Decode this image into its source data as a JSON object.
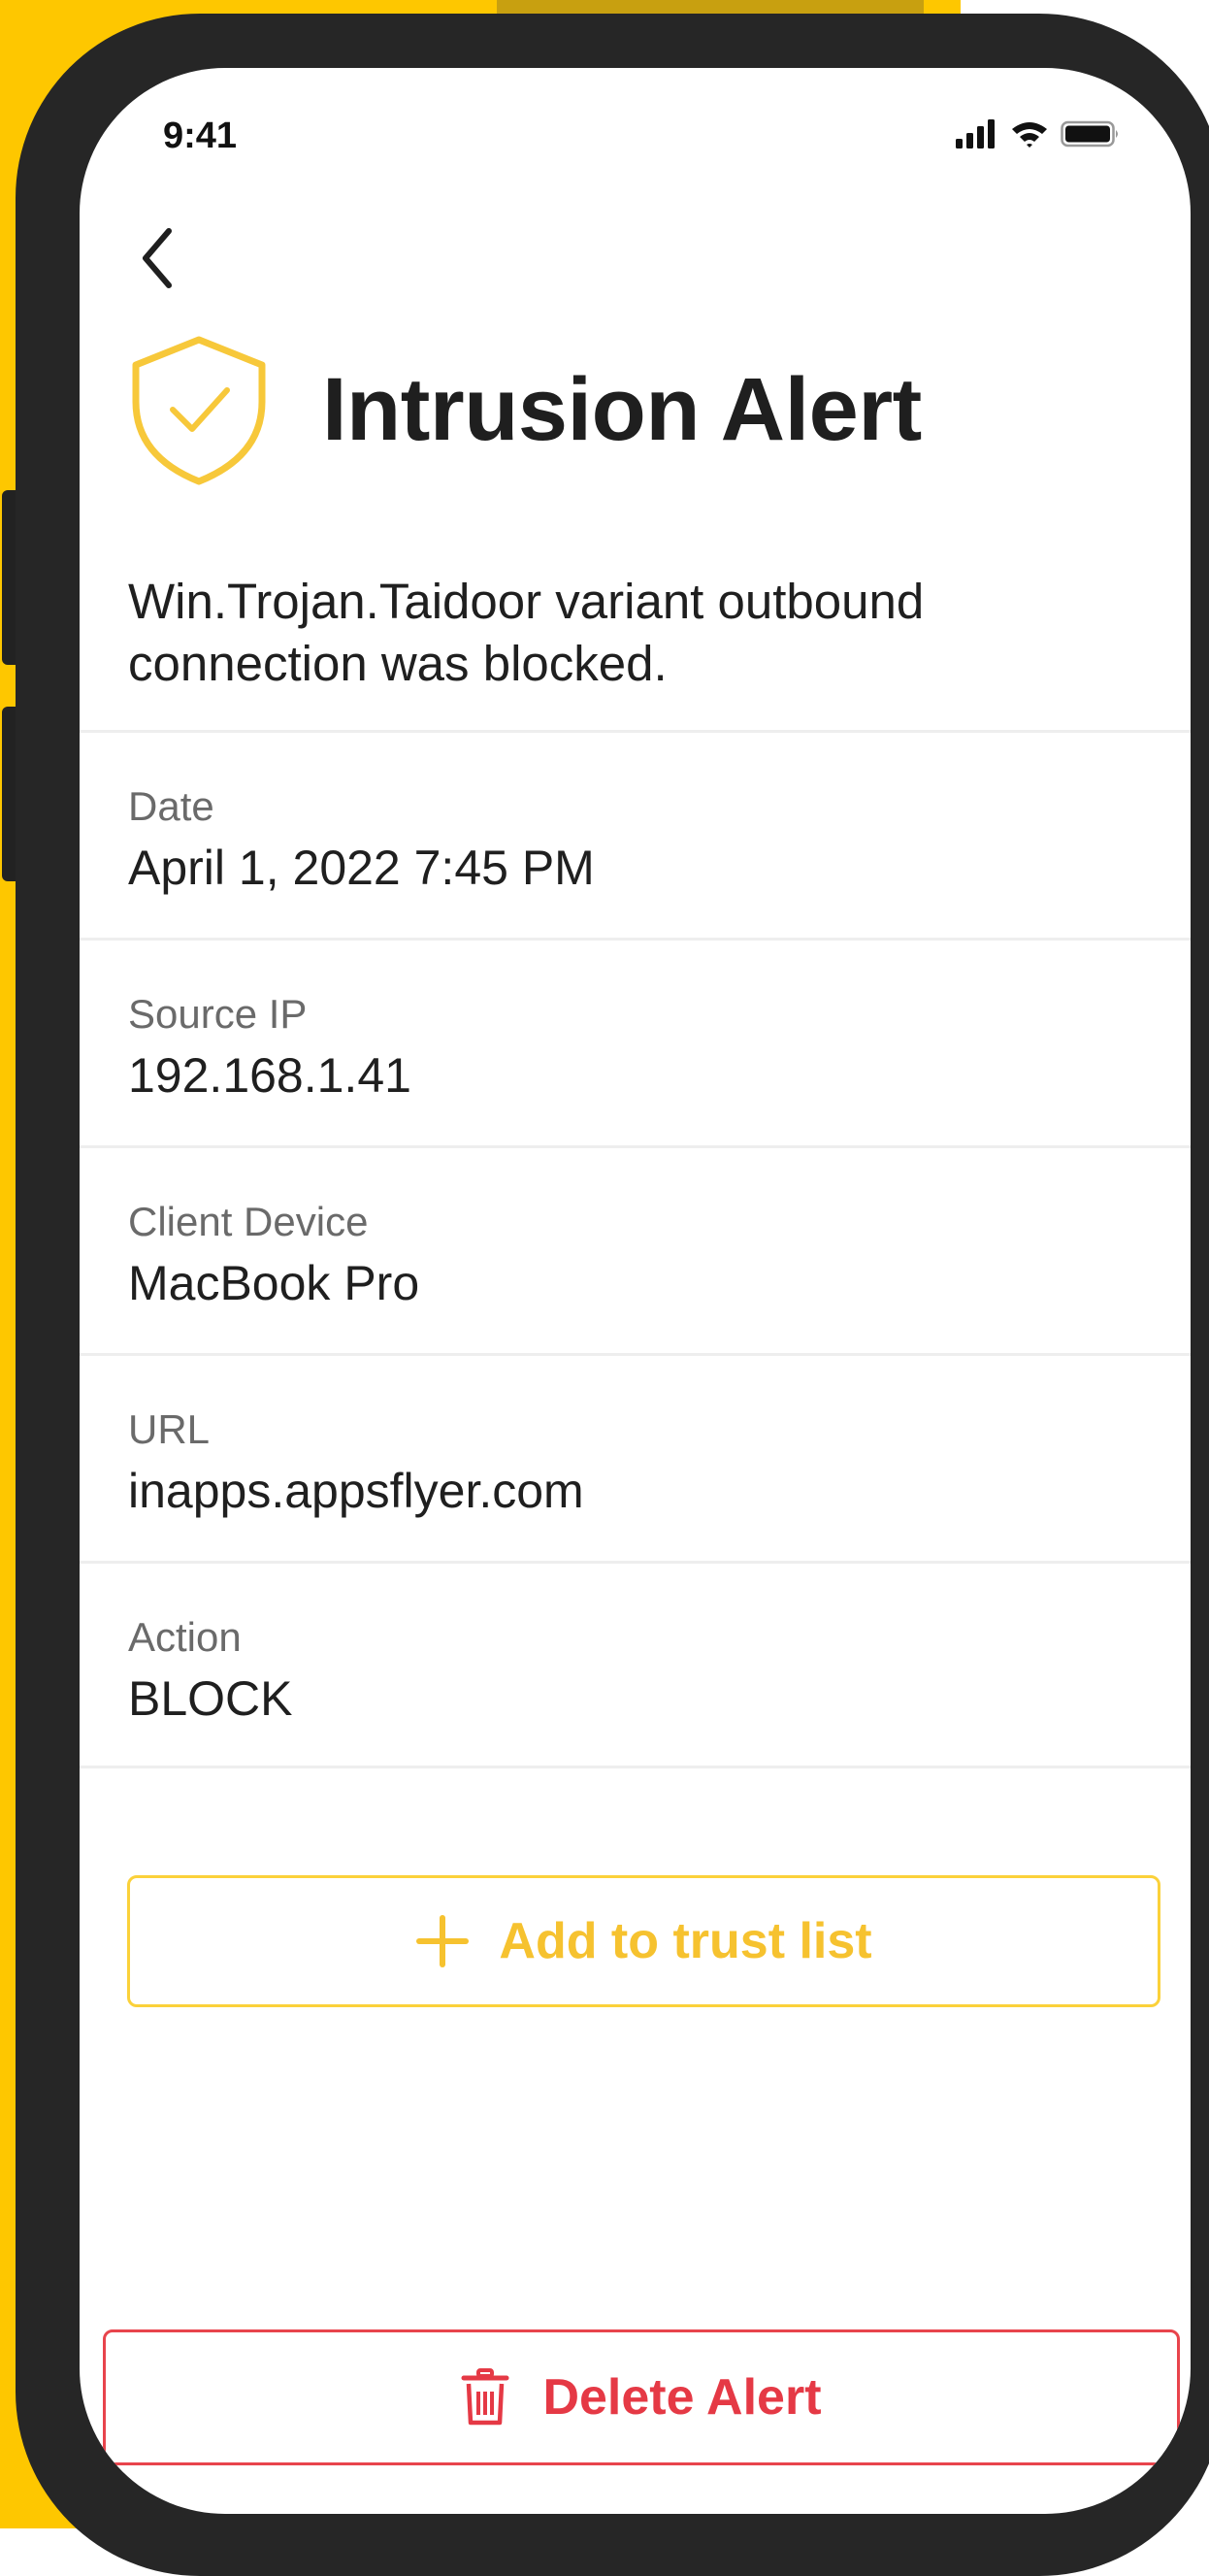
{
  "status_bar": {
    "time": "9:41"
  },
  "header": {
    "title": "Intrusion Alert"
  },
  "alert": {
    "description": "Win.Trojan.Taidoor variant outbound connection was blocked.",
    "details": [
      {
        "label": "Date",
        "value": "April 1, 2022 7:45 PM"
      },
      {
        "label": "Source IP",
        "value": "192.168.1.41"
      },
      {
        "label": "Client Device",
        "value": "MacBook Pro"
      },
      {
        "label": "URL",
        "value": "inapps.appsflyer.com"
      },
      {
        "label": "Action",
        "value": "BLOCK"
      }
    ]
  },
  "actions": {
    "trust_label": "Add to trust list",
    "delete_label": "Delete Alert"
  },
  "icons": {
    "back": "chevron-left-icon",
    "shield": "shield-check-icon",
    "add": "plus-icon",
    "delete": "trash-icon",
    "signal": "signal-icon",
    "wifi": "wifi-icon",
    "battery": "battery-icon"
  },
  "colors": {
    "background": "#FEC700",
    "accent": "#F6C22F",
    "danger": "#E53945",
    "frame": "#262626"
  }
}
